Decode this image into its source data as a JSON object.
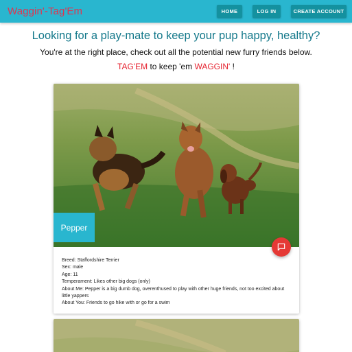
{
  "nav": {
    "brand": "Waggin'-Tag'Em",
    "home_label": "HOME",
    "login_label": "LOG IN",
    "create_account_label": "CREATE ACCOUNT"
  },
  "intro": {
    "headline": "Looking for a play-mate to keep your pup happy, healthy?",
    "subline": "You're at the right place, check out all the potential new furry friends below.",
    "tag_word": "TAG'EM",
    "tag_middle": " to keep 'em ",
    "waggin_word": "WAGGIN'",
    "tag_end": " !"
  },
  "dogs": [
    {
      "name": "Pepper",
      "breed": "Breed: Staffordshire Terrier",
      "sex": "Sex: male",
      "age": "Age: 11",
      "temperament": "Temperament: Likes other big dogs (only)",
      "about_me": "About Me: Pepper is a big dumb dog, overenthused to play with other huge friends, not too excited about little yappers",
      "about_you": "About You: Friends to go hike with or go for a swim"
    }
  ],
  "icons": {
    "chat": "chat-bubble-icon"
  },
  "colors": {
    "navbar": "#29b6cf",
    "brand": "#e0344f",
    "button": "#14919f",
    "headline": "#13788a",
    "accent_red": "#e5222f",
    "fab": "#e53935"
  }
}
